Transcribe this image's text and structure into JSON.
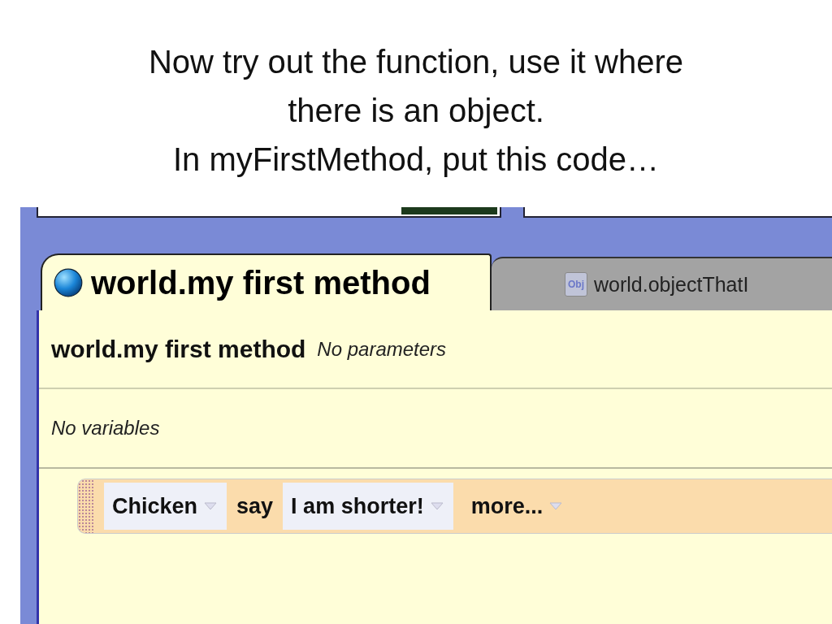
{
  "title": [
    "Now try out the function, use it where",
    "there is an object.",
    "In myFirstMethod, put this code…"
  ],
  "tabs": [
    {
      "label": "world.my first method",
      "selected": true,
      "kind": "method"
    },
    {
      "label": "world.objectThatI",
      "selected": false,
      "kind": "function",
      "icon_text": "Obj"
    }
  ],
  "method": {
    "name": "world.my first method",
    "parameters": "No parameters",
    "variables": "No variables"
  },
  "statement": [
    {
      "kind": "dropdown",
      "text": "Chicken"
    },
    {
      "kind": "word",
      "text": "say"
    },
    {
      "kind": "dropdown",
      "text": "I am shorter!"
    },
    {
      "kind": "dropdown",
      "text": "more..."
    }
  ]
}
